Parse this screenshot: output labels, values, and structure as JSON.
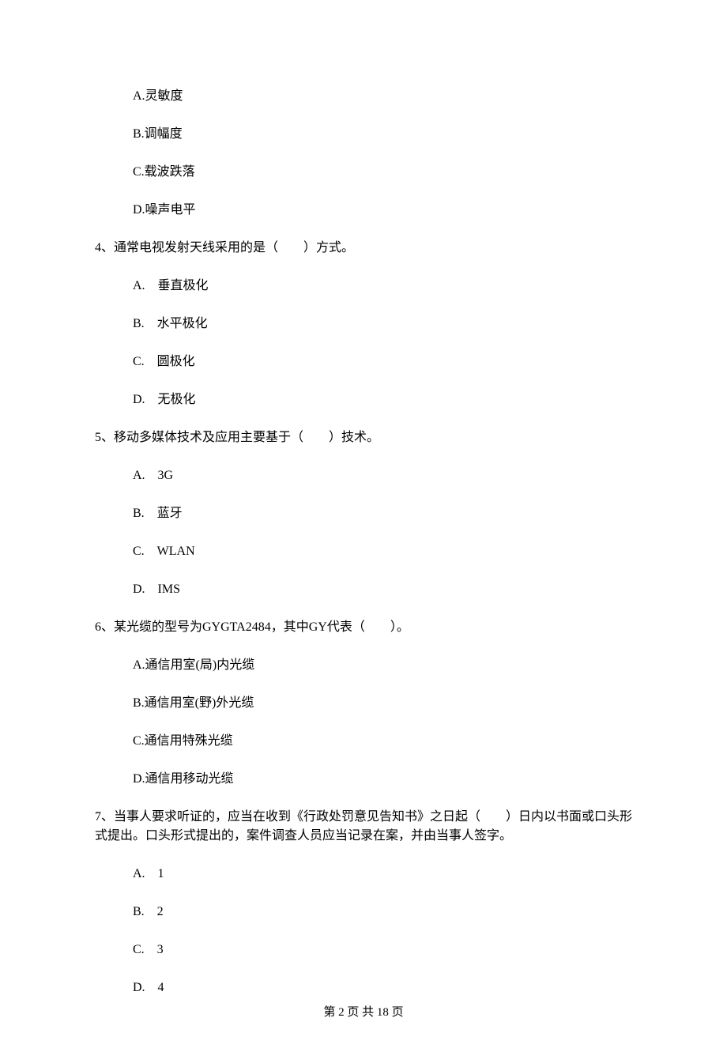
{
  "q3": {
    "options": {
      "A": "A.灵敏度",
      "B": "B.调幅度",
      "C": "C.载波跌落",
      "D": "D.噪声电平"
    }
  },
  "q4": {
    "stem": "4、通常电视发射天线采用的是（　　）方式。",
    "options": {
      "A": "A.　垂直极化",
      "B": "B.　水平极化",
      "C": "C.　圆极化",
      "D": "D.　无极化"
    }
  },
  "q5": {
    "stem": "5、移动多媒体技术及应用主要基于（　　）技术。",
    "options": {
      "A": "A.　3G",
      "B": "B.　蓝牙",
      "C": "C.　WLAN",
      "D": "D.　IMS"
    }
  },
  "q6": {
    "stem": "6、某光缆的型号为GYGTA2484，其中GY代表（　　）。",
    "options": {
      "A": "A.通信用室(局)内光缆",
      "B": "B.通信用室(野)外光缆",
      "C": "C.通信用特殊光缆",
      "D": "D.通信用移动光缆"
    }
  },
  "q7": {
    "stem": "7、当事人要求听证的，应当在收到《行政处罚意见告知书》之日起（　　）日内以书面或口头形式提出。口头形式提出的，案件调查人员应当记录在案，并由当事人签字。",
    "options": {
      "A": "A.　1",
      "B": "B.　2",
      "C": "C.　3",
      "D": "D.　4"
    }
  },
  "footer": "第 2 页 共 18 页"
}
